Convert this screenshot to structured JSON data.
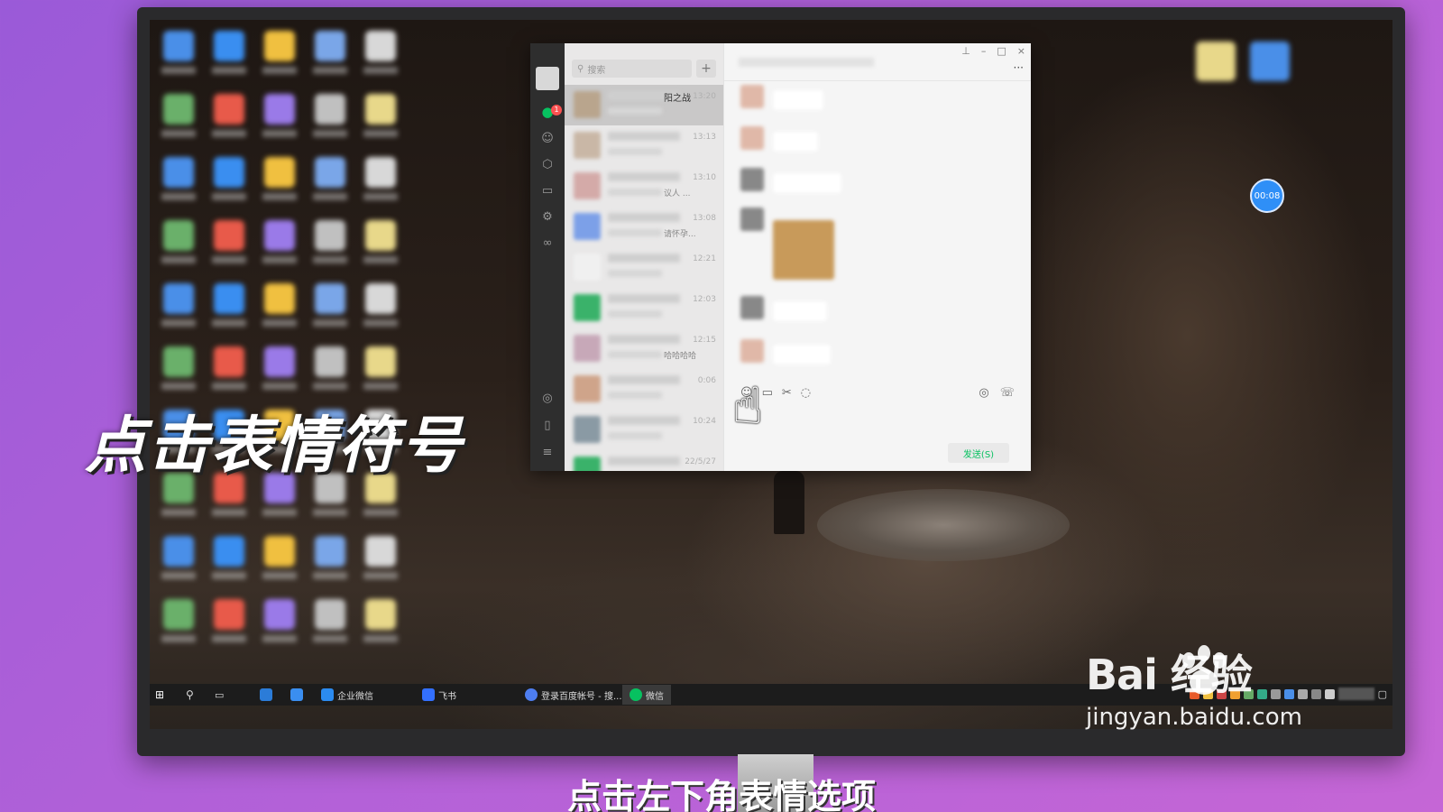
{
  "overlay": {
    "big_caption": "点击表情符号",
    "bottom_caption": "点击左下角表情选项",
    "timer": "00:08"
  },
  "wechat": {
    "search_placeholder": "搜索",
    "add_label": "+",
    "nav_badge": "1",
    "window_controls": [
      "⊥",
      "–",
      "□",
      "×"
    ],
    "more_label": "···",
    "send_button": "发送(S)",
    "conversations": [
      {
        "name": "阳之战",
        "preview": "",
        "time": "13:20",
        "active": true,
        "color": "#b9a58d"
      },
      {
        "name": "",
        "preview": "",
        "time": "13:13",
        "active": false,
        "color": "#c9b7a6"
      },
      {
        "name": "",
        "preview": "议人 ...",
        "time": "13:10",
        "active": false,
        "color": "#d4aaa8"
      },
      {
        "name": "",
        "preview": "请怀孕...",
        "time": "13:08",
        "active": false,
        "color": "#7ca0e8"
      },
      {
        "name": "",
        "preview": "",
        "time": "12:21",
        "active": false,
        "color": "#f0f0f0"
      },
      {
        "name": "",
        "preview": "",
        "time": "12:03",
        "active": false,
        "color": "#3ab26a"
      },
      {
        "name": "",
        "preview": "哈哈哈哈",
        "time": "12:15",
        "active": false,
        "color": "#c7a8b8"
      },
      {
        "name": "",
        "preview": "",
        "time": "0:06",
        "active": false,
        "color": "#cfa48a"
      },
      {
        "name": "",
        "preview": "",
        "time": "10:24",
        "active": false,
        "color": "#8a9aa4"
      },
      {
        "name": "",
        "preview": "",
        "time": "22/5/27",
        "active": false,
        "color": "#3ab26a"
      }
    ]
  },
  "taskbar": {
    "items": [
      {
        "label": "企业微信",
        "color": "#2b8bf0"
      },
      {
        "label": "飞书",
        "color": "#3370ff"
      },
      {
        "label": "登录百度帐号 - 搜...",
        "color": "#4e7ef0"
      },
      {
        "label": "微信",
        "color": "#07c160"
      }
    ]
  },
  "watermark": {
    "logo": "Bai  经验",
    "site": "jingyan.baidu.com"
  },
  "colors": {
    "wechat_green": "#07c160",
    "badge_red": "#fa5151",
    "timer_blue": "#2f8ff7"
  }
}
